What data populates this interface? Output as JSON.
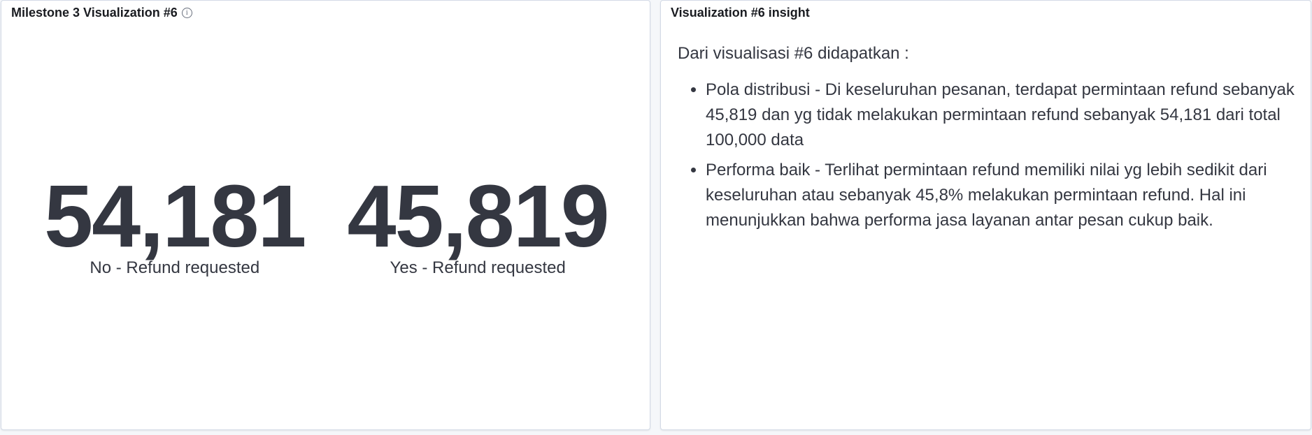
{
  "left_panel": {
    "title": "Milestone 3 Visualization #6",
    "info_icon": "info-icon",
    "metrics": [
      {
        "value": "54,181",
        "label": "No - Refund requested"
      },
      {
        "value": "45,819",
        "label": "Yes - Refund requested"
      }
    ]
  },
  "right_panel": {
    "title": "Visualization #6 insight",
    "intro": "Dari visualisasi #6 didapatkan :",
    "bullets": [
      "Pola distribusi - Di keseluruhan pesanan, terdapat permintaan refund sebanyak 45,819 dan yg tidak melakukan permintaan refund sebanyak 54,181 dari total 100,000 data",
      "Performa baik - Terlihat permintaan refund memiliki nilai yg lebih sedikit dari keseluruhan atau sebanyak 45,8% melakukan permintaan refund. Hal ini menunjukkan bahwa performa jasa layanan antar pesan cukup baik."
    ]
  }
}
